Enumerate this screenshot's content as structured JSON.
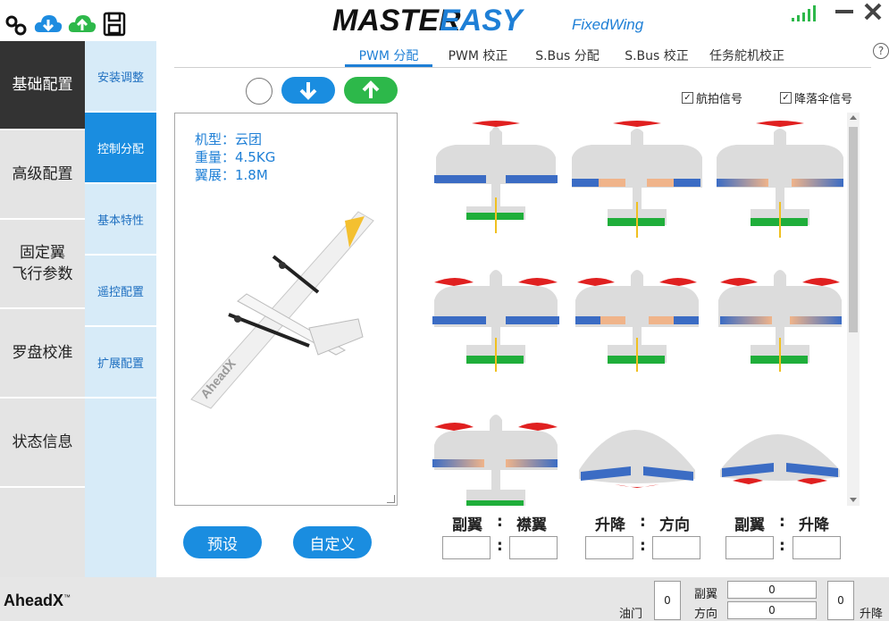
{
  "header": {
    "title_master": "MASTER",
    "title_easy": "EASY",
    "subtitle_fixed": "Fixed",
    "subtitle_wing": "Wing",
    "icons": [
      "link-icon",
      "cloud-download-icon",
      "cloud-upload-icon",
      "save-icon",
      "signal-icon",
      "minimize-icon",
      "close-icon"
    ]
  },
  "leftnav": {
    "items": [
      {
        "label": "基础配置",
        "active": true
      },
      {
        "label": "高级配置",
        "active": false
      },
      {
        "label": "固定翼\n飞行参数",
        "active": false
      },
      {
        "label": "罗盘校准",
        "active": false
      },
      {
        "label": "状态信息",
        "active": false
      }
    ]
  },
  "subnav": {
    "items": [
      {
        "label": "安装调整",
        "active": false
      },
      {
        "label": "控制分配",
        "active": true
      },
      {
        "label": "基本特性",
        "active": false
      },
      {
        "label": "遥控配置",
        "active": false
      },
      {
        "label": "扩展配置",
        "active": false
      }
    ]
  },
  "tabs": [
    {
      "label": "PWM 分配",
      "active": true
    },
    {
      "label": "PWM 校正",
      "active": false
    },
    {
      "label": "S.Bus 分配",
      "active": false
    },
    {
      "label": "S.Bus 校正",
      "active": false
    },
    {
      "label": "任务舵机校正",
      "active": false
    }
  ],
  "help": "?",
  "aircraft": {
    "model_label": "机型：云团",
    "weight_label": "重量：4.5KG",
    "span_label": "翼展：1.8M",
    "image_icon": "fixed-wing-vtol-aircraft",
    "image_brand": "AheadX"
  },
  "checkboxes": [
    {
      "label": "航拍信号",
      "checked": true
    },
    {
      "label": "降落伞信号",
      "checked": true
    }
  ],
  "ratios": {
    "group1": {
      "left": "副翼",
      "right": "襟翼",
      "sep": ":"
    },
    "group2": {
      "left": "升降",
      "right": "方向",
      "sep": ":"
    },
    "group3": {
      "left": "副翼",
      "right": "升降",
      "sep": ":"
    }
  },
  "buttons": {
    "preset": "预设",
    "custom": "自定义"
  },
  "footer": {
    "brand": "AheadX",
    "brand_tm": "™",
    "throttle_label": "油门",
    "throttle_value": "0",
    "aileron_label": "副翼",
    "aileron_value": "0",
    "rudder_label": "方向",
    "rudder_value": "0",
    "elevator_label": "升降",
    "elevator_value": "0"
  },
  "colors": {
    "accent": "#1a8de0",
    "green": "#2db84a",
    "red": "#e02020",
    "blue_surface": "#3b6cc4",
    "orange_surface": "#f0b48a",
    "green_surface": "#1fae3a"
  }
}
